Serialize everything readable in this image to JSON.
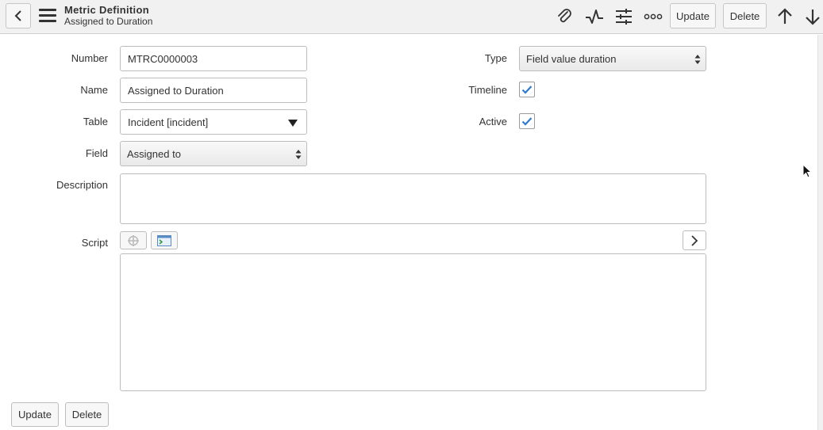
{
  "header": {
    "title": "Metric Definition",
    "subtitle": "Assigned to Duration",
    "update_label": "Update",
    "delete_label": "Delete"
  },
  "form": {
    "number": {
      "label": "Number",
      "value": "MTRC0000003"
    },
    "name": {
      "label": "Name",
      "value": "Assigned to Duration"
    },
    "table": {
      "label": "Table",
      "value": "Incident [incident]"
    },
    "field": {
      "label": "Field",
      "value": "Assigned to"
    },
    "description": {
      "label": "Description",
      "value": ""
    },
    "script": {
      "label": "Script",
      "value": ""
    },
    "type": {
      "label": "Type",
      "value": "Field value duration"
    },
    "timeline": {
      "label": "Timeline",
      "checked": true
    },
    "active": {
      "label": "Active",
      "checked": true
    }
  },
  "footer": {
    "update_label": "Update",
    "delete_label": "Delete"
  },
  "icons": {
    "back": "chevron-left-icon",
    "menu": "hamburger-icon",
    "attachment": "paperclip-icon",
    "activity": "activity-pulse-icon",
    "personalize": "sliders-icon",
    "more": "more-options-icon",
    "prev": "arrow-up-icon",
    "next": "arrow-down-icon"
  },
  "colors": {
    "header_bg": "#f1f1f1",
    "check": "#2f7bd1"
  }
}
